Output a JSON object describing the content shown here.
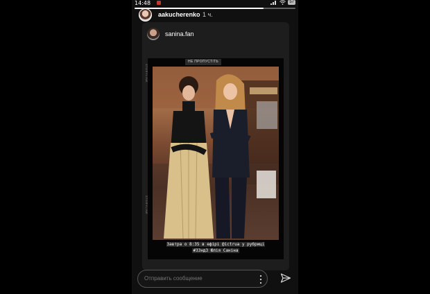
{
  "status_bar": {
    "time": "14:48",
    "battery": "57"
  },
  "story": {
    "progress": 0.8,
    "username": "aakucherenko",
    "time_ago": "1 ч."
  },
  "card": {
    "username": "sanina.fan",
    "tag": "НЕ ПРОПУСТІТЬ",
    "side_top": "STORYLINE",
    "side_bottom": "STORYLINE",
    "caption_line1": "Завтра о 8:35 в ефірі @ictrua у рубриці",
    "caption_line2": "#33нд3 Юлія Саніна"
  },
  "reply": {
    "placeholder": "Отправить сообщение"
  },
  "icons": {
    "more": "more-vertical-icon",
    "send": "send-icon"
  },
  "colors": {
    "background": "#000000",
    "phone_bg": "#101010",
    "card_bg": "#1d1d1d"
  }
}
